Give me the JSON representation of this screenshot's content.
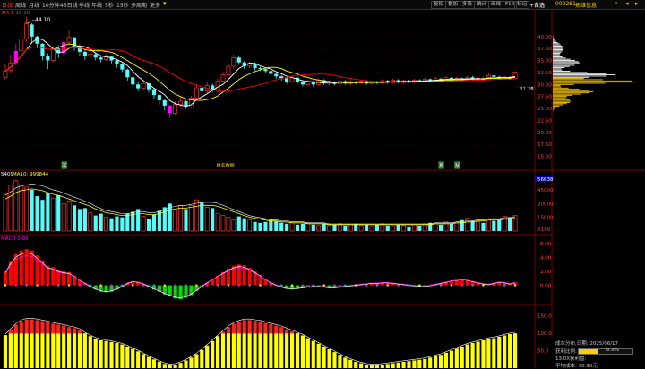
{
  "toolbar": {
    "items": [
      "日线",
      "周线",
      "月线",
      "10分钟",
      "45日线",
      "季线",
      "年线",
      "5秒",
      "15秒",
      "多周期",
      "更多"
    ],
    "active_index": 0,
    "right_buttons": [
      "复权",
      "叠加",
      "多股",
      "统计",
      "画线",
      "F10",
      "标记"
    ],
    "add_watch": "+自选",
    "stock_code": "002261",
    "stock_name": "拓维信息"
  },
  "main_chart": {
    "ma_label": "MA 5 10 20",
    "high_label": "44.10",
    "last_price_label": "31.26",
    "last_price_suffix": "3",
    "y_ticks": [
      "40.00",
      "37.50",
      "35.00",
      "32.50",
      "30.00",
      "27.50",
      "25.00",
      "22.50",
      "20.00",
      "17.50",
      "15.00"
    ],
    "y_min": 12.5,
    "y_max": 45,
    "markers": [
      {
        "label": "买",
        "index": 11
      },
      {
        "label": "财务数据",
        "index": 40
      },
      {
        "label": "股",
        "index": 82
      },
      {
        "label": "N",
        "index": 85
      }
    ]
  },
  "volume_chart": {
    "label_left": "5409",
    "label_ma": "MA10: 999844",
    "y_ticks": [
      "56638",
      "45000",
      "30000",
      "15000",
      "X100"
    ],
    "y_max": 56638
  },
  "macd_chart": {
    "label": "MACD 0.00",
    "y_ticks": [
      "6.00",
      "4.00",
      "2.00",
      "0.00"
    ],
    "y_min": -2.5,
    "y_max": 6.5
  },
  "bottom_chart": {
    "y_ticks": [
      "150.0",
      "100.0",
      "50.0"
    ],
    "y_max": 175
  },
  "chip_info": {
    "title": "成本分布,日期: 2025/06/17",
    "profit_label": "获利比例:",
    "profit_value": "8.9%",
    "profit_fraction": 0.089,
    "profit_detail": "13.0X获利盘:",
    "avg_cost": "平均成本: 30.90元"
  },
  "colors": {
    "up": "#ff3232",
    "down": "#54fcfc",
    "ma5": "#ffffff",
    "ma10": "#ffff00",
    "ma20": "#ff0000",
    "accent": "#ffcc00",
    "magenta": "#ff00ff",
    "macd_up": "#ff0000",
    "macd_down": "#00e000",
    "bottom_bar": "#ffff00"
  },
  "kline": [
    [
      31.5,
      32.8,
      34.2,
      31.0
    ],
    [
      33.0,
      34.5,
      36.2,
      32.5
    ],
    [
      34.5,
      37.0,
      38.5,
      34.0
    ],
    [
      37.0,
      39.5,
      41.5,
      36.5
    ],
    [
      39.5,
      42.8,
      44.1,
      38.8
    ],
    [
      42.5,
      40.0,
      42.8,
      38.5
    ],
    [
      40.0,
      38.5,
      40.2,
      37.6
    ],
    [
      38.5,
      36.0,
      38.6,
      35.0
    ],
    [
      36.0,
      35.0,
      36.5,
      33.2
    ],
    [
      35.0,
      37.5,
      38.0,
      34.6
    ],
    [
      37.5,
      36.5,
      38.2,
      35.5
    ],
    [
      36.5,
      38.8,
      39.5,
      36.0
    ],
    [
      38.8,
      39.8,
      41.2,
      38.2
    ],
    [
      39.8,
      38.0,
      40.0,
      37.0
    ],
    [
      38.0,
      36.8,
      38.3,
      36.0
    ],
    [
      36.8,
      35.9,
      37.2,
      35.1
    ],
    [
      35.9,
      36.3,
      36.8,
      35.3
    ],
    [
      36.3,
      35.6,
      36.7,
      35.0
    ],
    [
      35.6,
      35.2,
      36.1,
      34.6
    ],
    [
      35.2,
      35.8,
      36.3,
      34.9
    ],
    [
      35.8,
      35.0,
      36.0,
      34.4
    ],
    [
      35.0,
      34.3,
      35.3,
      33.5
    ],
    [
      34.3,
      33.1,
      34.5,
      32.6
    ],
    [
      33.1,
      31.5,
      33.3,
      30.8
    ],
    [
      31.5,
      30.0,
      31.7,
      29.4
    ],
    [
      30.0,
      29.2,
      30.5,
      28.6
    ],
    [
      29.2,
      30.2,
      30.6,
      28.8
    ],
    [
      30.2,
      29.0,
      30.4,
      28.3
    ],
    [
      29.0,
      27.8,
      29.2,
      27.0
    ],
    [
      27.8,
      26.7,
      28.0,
      25.8
    ],
    [
      26.7,
      25.6,
      27.0,
      24.6
    ],
    [
      25.6,
      24.0,
      25.8,
      23.0
    ],
    [
      24.0,
      25.8,
      26.5,
      23.7
    ],
    [
      25.8,
      26.5,
      27.3,
      25.3
    ],
    [
      26.5,
      25.3,
      26.8,
      24.9
    ],
    [
      25.3,
      27.2,
      27.6,
      25.0
    ],
    [
      27.2,
      29.3,
      29.8,
      26.9
    ],
    [
      29.3,
      28.6,
      29.6,
      27.9
    ],
    [
      28.6,
      29.8,
      30.4,
      28.2
    ],
    [
      29.8,
      28.9,
      30.2,
      28.4
    ],
    [
      28.9,
      30.7,
      31.3,
      28.6
    ],
    [
      30.7,
      32.0,
      32.6,
      30.4
    ],
    [
      32.0,
      33.8,
      34.3,
      31.6
    ],
    [
      33.8,
      35.6,
      36.2,
      33.3
    ],
    [
      35.6,
      34.6,
      35.9,
      34.1
    ],
    [
      34.6,
      33.8,
      34.9,
      33.2
    ],
    [
      33.8,
      34.4,
      34.8,
      33.4
    ],
    [
      34.4,
      33.4,
      34.6,
      32.9
    ],
    [
      33.4,
      33.2,
      33.8,
      32.8
    ],
    [
      33.2,
      32.8,
      33.5,
      32.3
    ],
    [
      32.8,
      32.2,
      33.0,
      31.7
    ],
    [
      32.2,
      31.7,
      32.4,
      31.2
    ],
    [
      31.7,
      31.3,
      32.0,
      30.8
    ],
    [
      31.3,
      30.6,
      31.5,
      30.1
    ],
    [
      30.6,
      31.4,
      31.8,
      30.3
    ],
    [
      31.4,
      30.6,
      31.6,
      30.1
    ],
    [
      30.6,
      30.0,
      30.9,
      29.6
    ],
    [
      30.0,
      30.6,
      31.0,
      29.7
    ],
    [
      30.6,
      30.0,
      30.8,
      29.5
    ],
    [
      30.0,
      30.9,
      31.3,
      29.8
    ],
    [
      30.9,
      30.2,
      31.1,
      29.9
    ],
    [
      30.2,
      30.5,
      30.8,
      29.9
    ],
    [
      30.5,
      30.1,
      30.7,
      29.8
    ],
    [
      30.1,
      30.7,
      31.1,
      30.0
    ],
    [
      30.7,
      30.2,
      30.9,
      29.9
    ],
    [
      30.2,
      30.6,
      30.9,
      29.9
    ],
    [
      30.6,
      30.3,
      30.8,
      30.0
    ],
    [
      30.3,
      30.7,
      31.0,
      30.1
    ],
    [
      30.7,
      30.2,
      30.9,
      29.9
    ],
    [
      30.2,
      30.6,
      30.8,
      30.0
    ],
    [
      30.6,
      30.3,
      30.8,
      30.0
    ],
    [
      30.3,
      30.8,
      31.1,
      30.1
    ],
    [
      30.8,
      30.4,
      31.0,
      30.1
    ],
    [
      30.4,
      30.9,
      31.2,
      30.2
    ],
    [
      30.9,
      30.4,
      31.1,
      30.2
    ],
    [
      30.4,
      30.8,
      31.0,
      30.2
    ],
    [
      30.8,
      30.5,
      31.0,
      30.3
    ],
    [
      30.5,
      30.9,
      31.2,
      30.3
    ],
    [
      30.9,
      30.6,
      31.1,
      30.4
    ],
    [
      30.6,
      31.1,
      31.4,
      30.5
    ],
    [
      31.1,
      30.7,
      31.3,
      30.5
    ],
    [
      30.7,
      31.2,
      31.6,
      30.5
    ],
    [
      31.2,
      30.9,
      31.4,
      30.6
    ],
    [
      30.9,
      31.4,
      31.8,
      30.7
    ],
    [
      31.4,
      31.0,
      31.6,
      30.8
    ],
    [
      31.0,
      31.3,
      31.6,
      30.8
    ],
    [
      31.3,
      30.9,
      31.5,
      30.7
    ],
    [
      30.9,
      31.5,
      31.8,
      30.8
    ],
    [
      31.5,
      31.1,
      31.8,
      30.9
    ],
    [
      31.1,
      31.3,
      31.6,
      30.9
    ],
    [
      31.3,
      31.0,
      31.5,
      30.8
    ],
    [
      31.0,
      31.9,
      32.3,
      30.9
    ],
    [
      31.9,
      31.6,
      32.3,
      31.2
    ],
    [
      31.6,
      31.3,
      31.8,
      31.0
    ],
    [
      31.3,
      31.5,
      31.8,
      31.1
    ],
    [
      31.5,
      31.2,
      31.7,
      31.0
    ],
    [
      31.2,
      32.6,
      32.8,
      31.1
    ]
  ],
  "volume": [
    40,
    50,
    55,
    50,
    48,
    45,
    38,
    34,
    42,
    36,
    39,
    30,
    33,
    28,
    24,
    25,
    20,
    17,
    19,
    15,
    14,
    16,
    15,
    19,
    21,
    24,
    16,
    13,
    18,
    22,
    26,
    30,
    23,
    28,
    24,
    28,
    34,
    31,
    26,
    25,
    19,
    17,
    15,
    12,
    16,
    14,
    12,
    10,
    9,
    10,
    12,
    11,
    9,
    8,
    9,
    7,
    8,
    9,
    7,
    6,
    8,
    6,
    7,
    8,
    6,
    7,
    8,
    6,
    7,
    5,
    7,
    8,
    6,
    5,
    7,
    6,
    5,
    7,
    6,
    8,
    9,
    8,
    7,
    10,
    8,
    9,
    12,
    14,
    11,
    10,
    9,
    13,
    11,
    12,
    16,
    15,
    17
  ],
  "volume_ma": [
    35,
    38,
    42,
    44,
    45,
    46,
    45,
    44,
    42,
    40,
    39,
    37,
    35,
    33,
    31,
    29,
    27,
    24,
    22,
    20,
    19,
    18,
    17,
    17,
    18,
    19,
    19,
    18,
    18,
    19,
    21,
    23,
    24,
    25,
    25,
    26,
    27,
    28,
    28,
    28,
    27,
    25,
    23,
    21,
    19,
    17,
    15,
    14,
    13,
    12,
    11,
    11,
    10,
    10,
    9,
    9,
    9,
    8,
    8,
    8,
    8,
    7,
    7,
    7,
    7,
    7,
    7,
    7,
    7,
    7,
    7,
    7,
    7,
    7,
    7,
    7,
    7,
    7,
    7,
    7,
    7,
    8,
    8,
    8,
    8,
    9,
    9,
    10,
    10,
    11,
    11,
    12,
    12,
    12,
    13,
    13,
    14
  ],
  "macd": [
    2.0,
    3.5,
    4.5,
    5.0,
    5.2,
    5.0,
    4.3,
    3.6,
    2.8,
    2.6,
    2.2,
    2.0,
    1.9,
    1.4,
    0.8,
    0.3,
    -0.2,
    -0.6,
    -0.9,
    -1.0,
    -0.9,
    -0.6,
    -0.2,
    0.3,
    0.6,
    0.5,
    0.2,
    -0.2,
    -0.6,
    -0.9,
    -1.3,
    -1.6,
    -1.9,
    -2.0,
    -1.8,
    -1.4,
    -0.8,
    -0.2,
    0.4,
    0.9,
    1.4,
    1.9,
    2.4,
    2.8,
    3.0,
    2.9,
    2.5,
    2.0,
    1.5,
    0.9,
    0.4,
    0.0,
    -0.3,
    -0.5,
    -0.6,
    -0.5,
    -0.4,
    -0.3,
    -0.2,
    -0.2,
    -0.3,
    -0.4,
    -0.4,
    -0.3,
    -0.2,
    -0.1,
    0.0,
    0.1,
    0.2,
    0.3,
    0.3,
    0.4,
    0.4,
    0.3,
    0.2,
    0.1,
    0.0,
    -0.1,
    -0.2,
    -0.2,
    -0.1,
    0.1,
    0.3,
    0.5,
    0.7,
    0.8,
    0.9,
    0.8,
    0.6,
    0.4,
    0.2,
    0.1,
    0.3,
    0.5,
    0.4,
    0.2,
    0.4
  ],
  "bottom": [
    95,
    110,
    125,
    135,
    140,
    140,
    138,
    135,
    132,
    128,
    125,
    122,
    118,
    115,
    110,
    100,
    92,
    85,
    80,
    78,
    75,
    72,
    68,
    62,
    55,
    48,
    40,
    32,
    25,
    18,
    12,
    8,
    10,
    15,
    22,
    30,
    40,
    52,
    65,
    78,
    92,
    105,
    118,
    128,
    134,
    138,
    138,
    136,
    134,
    130,
    126,
    122,
    118,
    112,
    106,
    100,
    94,
    86,
    78,
    70,
    62,
    54,
    46,
    38,
    30,
    24,
    18,
    14,
    10,
    8,
    8,
    10,
    12,
    14,
    16,
    18,
    20,
    22,
    24,
    26,
    30,
    34,
    38,
    44,
    50,
    56,
    62,
    68,
    72,
    76,
    80,
    84,
    86,
    90,
    94,
    98,
    100
  ]
}
